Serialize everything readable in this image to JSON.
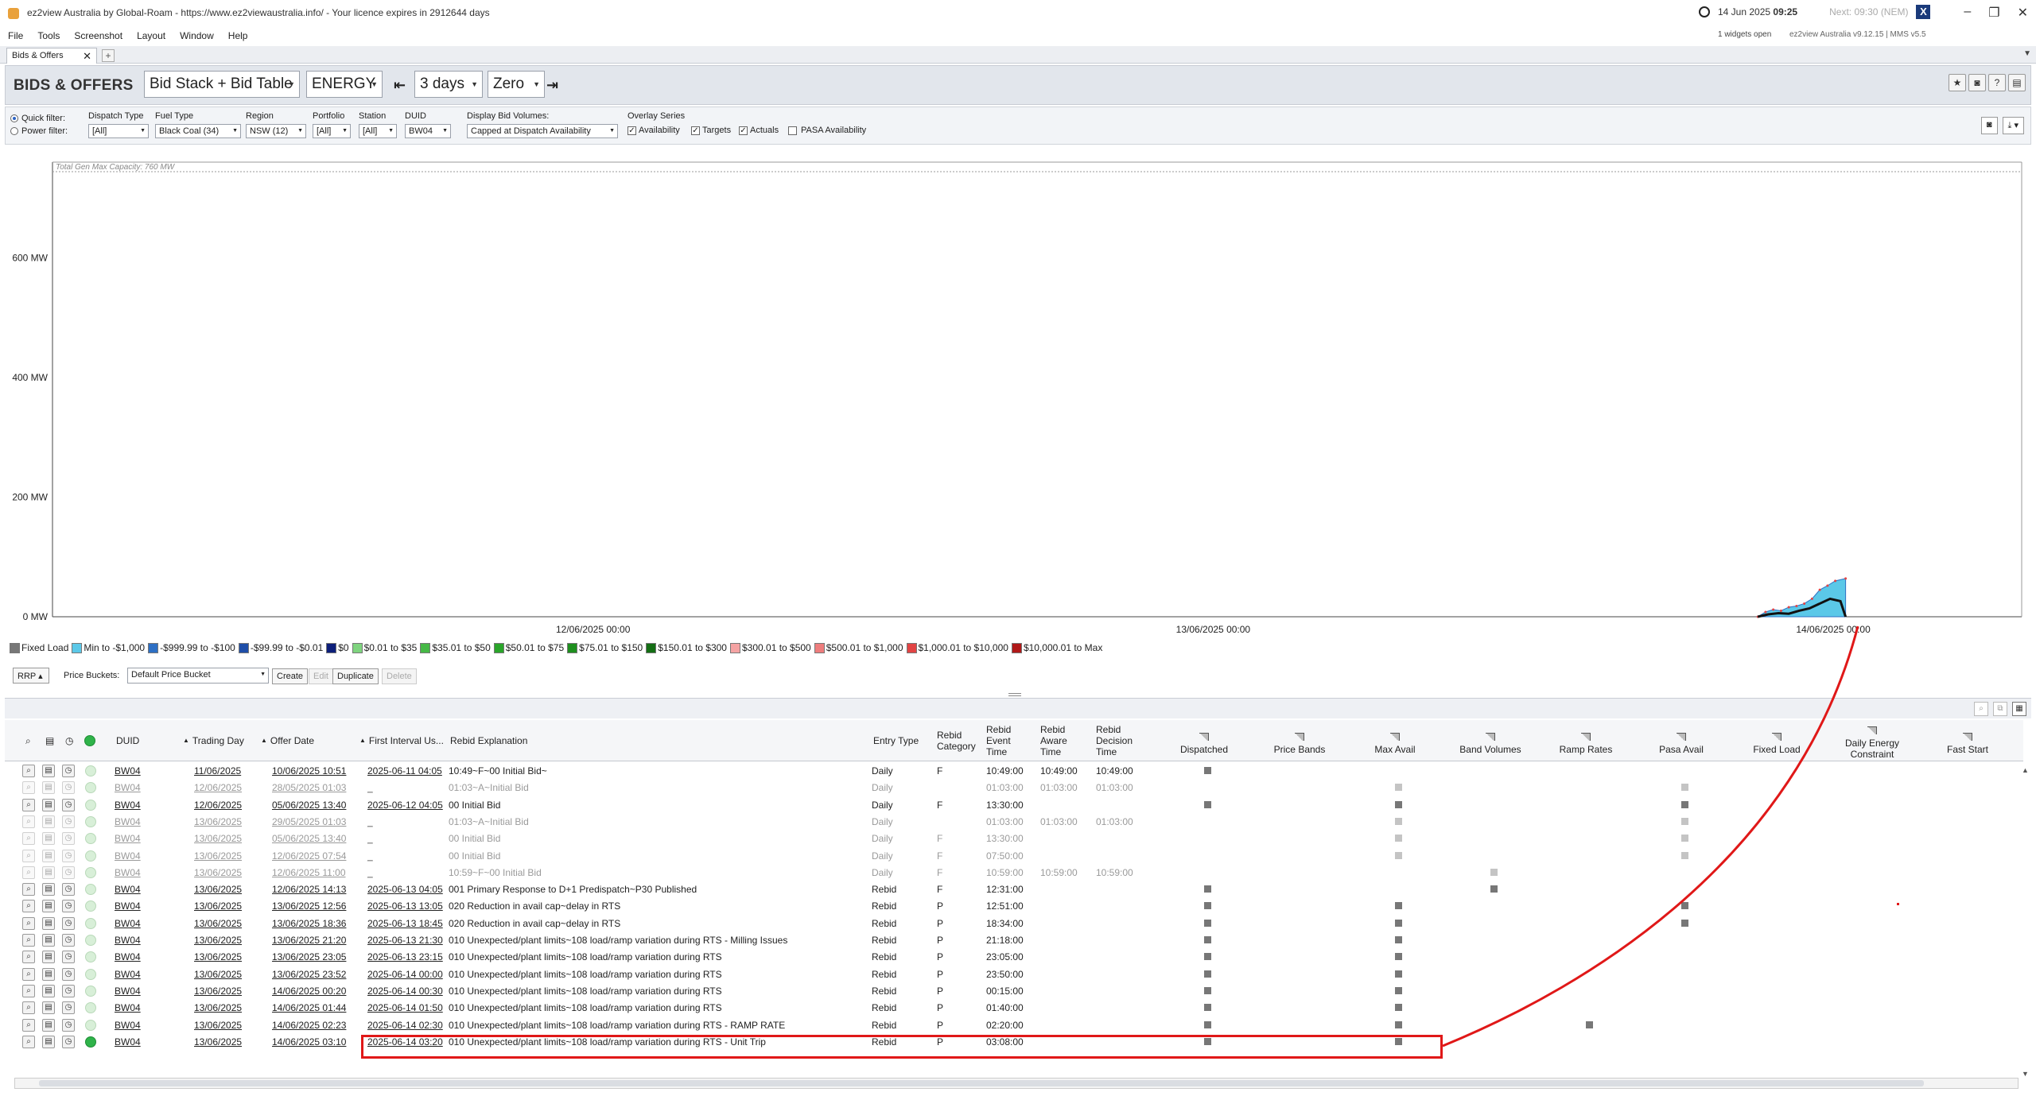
{
  "window": {
    "title": "ez2view Australia by Global-Roam - https://www.ez2viewaustralia.info/ - Your licence expires in 2912644 days",
    "clock_date": "14 Jun 2025",
    "clock_time": "09:25",
    "next_interval": "Next: 09:30 (NEM)",
    "widgets_open": "1 widgets open",
    "version": "ez2view Australia v9.12.15 | MMS v5.5",
    "brand": "X"
  },
  "menu": [
    "File",
    "Tools",
    "Screenshot",
    "Layout",
    "Window",
    "Help"
  ],
  "tab": {
    "label": "Bids & Offers"
  },
  "toolbar": {
    "heading": "BIDS & OFFERS",
    "view": "Bid Stack + Bid Table",
    "market": "ENERGY",
    "duration": "3 days",
    "zero": "Zero"
  },
  "filters": {
    "quick": "Quick filter:",
    "power": "Power filter:",
    "dispatch_type_label": "Dispatch Type",
    "dispatch_type": "[All]",
    "fuel_type_label": "Fuel Type",
    "fuel_type": "Black Coal (34)",
    "region_label": "Region",
    "region": "NSW (12)",
    "portfolio_label": "Portfolio",
    "portfolio": "[All]",
    "station_label": "Station",
    "station": "[All]",
    "duid_label": "DUID",
    "duid": "BW04",
    "display_bid_label": "Display Bid Volumes:",
    "display_bid": "Capped at Dispatch Availability",
    "overlay_label": "Overlay Series",
    "overlay": [
      {
        "label": "Availability",
        "checked": true
      },
      {
        "label": "Targets",
        "checked": true
      },
      {
        "label": "Actuals",
        "checked": true
      },
      {
        "label": "PASA Availability",
        "checked": false
      }
    ]
  },
  "chart_data": {
    "type": "area",
    "title": "",
    "annotation": "Total Gen Max Capacity: 760 MW",
    "xlabel": "",
    "ylabel": "",
    "ylim": [
      0,
      760
    ],
    "y_ticks": [
      "0 MW",
      "200 MW",
      "400 MW",
      "600 MW"
    ],
    "y_tick_values": [
      0,
      200,
      400,
      600
    ],
    "x_ticks": [
      "12/06/2025 00:00",
      "13/06/2025 00:00",
      "14/06/2025 00:00"
    ],
    "x_hours": [
      72
    ],
    "series": [
      {
        "name": "Min to -$1,000",
        "color": "#5bc8e8",
        "x_hours": [
          66.0,
          66.3,
          66.6,
          66.9,
          67.2,
          67.5,
          67.8,
          68.1,
          68.4,
          68.7,
          69.0,
          69.4
        ],
        "values": [
          0,
          8,
          12,
          10,
          16,
          18,
          22,
          30,
          45,
          52,
          60,
          64
        ]
      }
    ],
    "line": {
      "name": "Actuals",
      "x_hours": [
        66.0,
        66.4,
        66.8,
        67.2,
        67.6,
        68.0,
        68.4,
        68.8,
        69.2,
        69.4
      ],
      "values": [
        0,
        4,
        6,
        5,
        10,
        14,
        22,
        30,
        26,
        0
      ]
    }
  },
  "legend": [
    {
      "label": "Fixed Load",
      "color": "#777777"
    },
    {
      "label": "Min to -$1,000",
      "color": "#5bc8e8"
    },
    {
      "label": "-$999.99 to -$100",
      "color": "#2d6fc4"
    },
    {
      "label": "-$99.99 to -$0.01",
      "color": "#1f4ea8"
    },
    {
      "label": "$0",
      "color": "#0d1f7a"
    },
    {
      "label": "$0.01 to $35",
      "color": "#7fd47f"
    },
    {
      "label": "$35.01 to $50",
      "color": "#46b846"
    },
    {
      "label": "$50.01 to $75",
      "color": "#2aa52a"
    },
    {
      "label": "$75.01 to $150",
      "color": "#1e8f1e"
    },
    {
      "label": "$150.01 to $300",
      "color": "#146e14"
    },
    {
      "label": "$300.01 to $500",
      "color": "#f5a3a3"
    },
    {
      "label": "$500.01 to $1,000",
      "color": "#ee7d7d"
    },
    {
      "label": "$1,000.01 to $10,000",
      "color": "#e24444"
    },
    {
      "label": "$10,000.01 to Max",
      "color": "#b01818"
    }
  ],
  "bucket": {
    "rrp": "RRP",
    "label": "Price Buckets:",
    "value": "Default Price Bucket",
    "create": "Create",
    "edit": "Edit",
    "duplicate": "Duplicate",
    "delete": "Delete"
  },
  "table": {
    "headers": {
      "duid": "DUID",
      "trading_day": "Trading Day",
      "offer_date": "Offer Date",
      "first_interval": "First Interval Us...",
      "explanation": "Rebid Explanation",
      "entry_type": "Entry Type",
      "rebid_category": "Rebid Category",
      "event_time": "Rebid Event Time",
      "aware_time": "Rebid Aware Time",
      "decision_time": "Rebid Decision Time",
      "dispatched": "Dispatched",
      "price_bands": "Price Bands",
      "max_avail": "Max Avail",
      "band_volumes": "Band Volumes",
      "ramp_rates": "Ramp Rates",
      "pasa_avail": "Pasa Avail",
      "fixed_load": "Fixed Load",
      "daily_energy": "Daily Energy Constraint",
      "fast_start": "Fast Start"
    },
    "rows": [
      {
        "faded": false,
        "live": false,
        "duid": "BW04",
        "td": "11/06/2025",
        "od": "10/06/2025 10:51",
        "fi": "2025-06-11 04:05",
        "ex": "10:49~F~00 Initial Bid~",
        "et": "Daily",
        "rc": "F",
        "ev": "10:49:00",
        "aw": "10:49:00",
        "de": "10:49:00",
        "marks": {
          "dispatched": "dark"
        }
      },
      {
        "faded": true,
        "live": false,
        "duid": "BW04",
        "td": "12/06/2025",
        "od": "28/05/2025 01:03",
        "fi": "_",
        "ex": "01:03~A~Initial Bid",
        "et": "Daily",
        "rc": "",
        "ev": "01:03:00",
        "aw": "01:03:00",
        "de": "01:03:00",
        "marks": {
          "max_avail": "light",
          "pasa_avail": "light"
        }
      },
      {
        "faded": false,
        "live": false,
        "duid": "BW04",
        "td": "12/06/2025",
        "od": "05/06/2025 13:40",
        "fi": "2025-06-12 04:05",
        "ex": "00 Initial Bid",
        "et": "Daily",
        "rc": "F",
        "ev": "13:30:00",
        "aw": "",
        "de": "",
        "marks": {
          "dispatched": "dark",
          "max_avail": "dark",
          "pasa_avail": "dark"
        }
      },
      {
        "faded": true,
        "live": false,
        "duid": "BW04",
        "td": "13/06/2025",
        "od": "29/05/2025 01:03",
        "fi": "_",
        "ex": "01:03~A~Initial Bid",
        "et": "Daily",
        "rc": "",
        "ev": "01:03:00",
        "aw": "01:03:00",
        "de": "01:03:00",
        "marks": {
          "max_avail": "light",
          "pasa_avail": "light"
        }
      },
      {
        "faded": true,
        "live": false,
        "duid": "BW04",
        "td": "13/06/2025",
        "od": "05/06/2025 13:40",
        "fi": "_",
        "ex": "00 Initial Bid",
        "et": "Daily",
        "rc": "F",
        "ev": "13:30:00",
        "aw": "",
        "de": "",
        "marks": {
          "max_avail": "light",
          "pasa_avail": "light"
        }
      },
      {
        "faded": true,
        "live": false,
        "duid": "BW04",
        "td": "13/06/2025",
        "od": "12/06/2025 07:54",
        "fi": "_",
        "ex": "00 Initial Bid",
        "et": "Daily",
        "rc": "F",
        "ev": "07:50:00",
        "aw": "",
        "de": "",
        "marks": {
          "max_avail": "light",
          "pasa_avail": "light"
        }
      },
      {
        "faded": true,
        "live": false,
        "duid": "BW04",
        "td": "13/06/2025",
        "od": "12/06/2025 11:00",
        "fi": "_",
        "ex": "10:59~F~00 Initial Bid",
        "et": "Daily",
        "rc": "F",
        "ev": "10:59:00",
        "aw": "10:59:00",
        "de": "10:59:00",
        "marks": {
          "band_volumes": "light"
        }
      },
      {
        "faded": false,
        "live": false,
        "duid": "BW04",
        "td": "13/06/2025",
        "od": "12/06/2025 14:13",
        "fi": "2025-06-13 04:05",
        "ex": "001 Primary Response to D+1 Predispatch~P30 Published",
        "et": "Rebid",
        "rc": "F",
        "ev": "12:31:00",
        "aw": "",
        "de": "",
        "marks": {
          "dispatched": "dark",
          "band_volumes": "dark"
        }
      },
      {
        "faded": false,
        "live": false,
        "duid": "BW04",
        "td": "13/06/2025",
        "od": "13/06/2025 12:56",
        "fi": "2025-06-13 13:05",
        "ex": "020 Reduction in avail cap~delay in RTS",
        "et": "Rebid",
        "rc": "P",
        "ev": "12:51:00",
        "aw": "",
        "de": "",
        "marks": {
          "dispatched": "dark",
          "max_avail": "dark",
          "pasa_avail": "dark"
        }
      },
      {
        "faded": false,
        "live": false,
        "duid": "BW04",
        "td": "13/06/2025",
        "od": "13/06/2025 18:36",
        "fi": "2025-06-13 18:45",
        "ex": "020 Reduction in avail cap~delay in RTS",
        "et": "Rebid",
        "rc": "P",
        "ev": "18:34:00",
        "aw": "",
        "de": "",
        "marks": {
          "dispatched": "dark",
          "max_avail": "dark",
          "pasa_avail": "dark"
        }
      },
      {
        "faded": false,
        "live": false,
        "duid": "BW04",
        "td": "13/06/2025",
        "od": "13/06/2025 21:20",
        "fi": "2025-06-13 21:30",
        "ex": "010 Unexpected/plant limits~108 load/ramp variation during RTS - Milling Issues",
        "et": "Rebid",
        "rc": "P",
        "ev": "21:18:00",
        "aw": "",
        "de": "",
        "marks": {
          "dispatched": "dark",
          "max_avail": "dark"
        }
      },
      {
        "faded": false,
        "live": false,
        "duid": "BW04",
        "td": "13/06/2025",
        "od": "13/06/2025 23:05",
        "fi": "2025-06-13 23:15",
        "ex": "010 Unexpected/plant limits~108 load/ramp variation during RTS",
        "et": "Rebid",
        "rc": "P",
        "ev": "23:05:00",
        "aw": "",
        "de": "",
        "marks": {
          "dispatched": "dark",
          "max_avail": "dark"
        }
      },
      {
        "faded": false,
        "live": false,
        "duid": "BW04",
        "td": "13/06/2025",
        "od": "13/06/2025 23:52",
        "fi": "2025-06-14 00:00",
        "ex": "010 Unexpected/plant limits~108 load/ramp variation during RTS",
        "et": "Rebid",
        "rc": "P",
        "ev": "23:50:00",
        "aw": "",
        "de": "",
        "marks": {
          "dispatched": "dark",
          "max_avail": "dark"
        }
      },
      {
        "faded": false,
        "live": false,
        "duid": "BW04",
        "td": "13/06/2025",
        "od": "14/06/2025 00:20",
        "fi": "2025-06-14 00:30",
        "ex": "010 Unexpected/plant limits~108 load/ramp variation during RTS",
        "et": "Rebid",
        "rc": "P",
        "ev": "00:15:00",
        "aw": "",
        "de": "",
        "marks": {
          "dispatched": "dark",
          "max_avail": "dark"
        }
      },
      {
        "faded": false,
        "live": false,
        "duid": "BW04",
        "td": "13/06/2025",
        "od": "14/06/2025 01:44",
        "fi": "2025-06-14 01:50",
        "ex": "010 Unexpected/plant limits~108 load/ramp variation during RTS",
        "et": "Rebid",
        "rc": "P",
        "ev": "01:40:00",
        "aw": "",
        "de": "",
        "marks": {
          "dispatched": "dark",
          "max_avail": "dark"
        }
      },
      {
        "faded": false,
        "live": false,
        "duid": "BW04",
        "td": "13/06/2025",
        "od": "14/06/2025 02:23",
        "fi": "2025-06-14 02:30",
        "ex": "010 Unexpected/plant limits~108 load/ramp variation during RTS - RAMP RATE",
        "et": "Rebid",
        "rc": "P",
        "ev": "02:20:00",
        "aw": "",
        "de": "",
        "marks": {
          "dispatched": "dark",
          "max_avail": "dark",
          "ramp_rates": "dark"
        }
      },
      {
        "faded": false,
        "live": true,
        "duid": "BW04",
        "td": "13/06/2025",
        "od": "14/06/2025 03:10",
        "fi": "2025-06-14 03:20",
        "ex": "010 Unexpected/plant limits~108 load/ramp variation during RTS - Unit Trip",
        "et": "Rebid",
        "rc": "P",
        "ev": "03:08:00",
        "aw": "",
        "de": "",
        "marks": {
          "dispatched": "dark",
          "max_avail": "dark"
        }
      }
    ]
  },
  "colors": {
    "accent": "#e01818",
    "live": "#2fb34a"
  },
  "icons": [
    "clock-icon",
    "search-icon",
    "table-icon",
    "history-icon",
    "status-icon",
    "camera-icon",
    "download-icon"
  ]
}
